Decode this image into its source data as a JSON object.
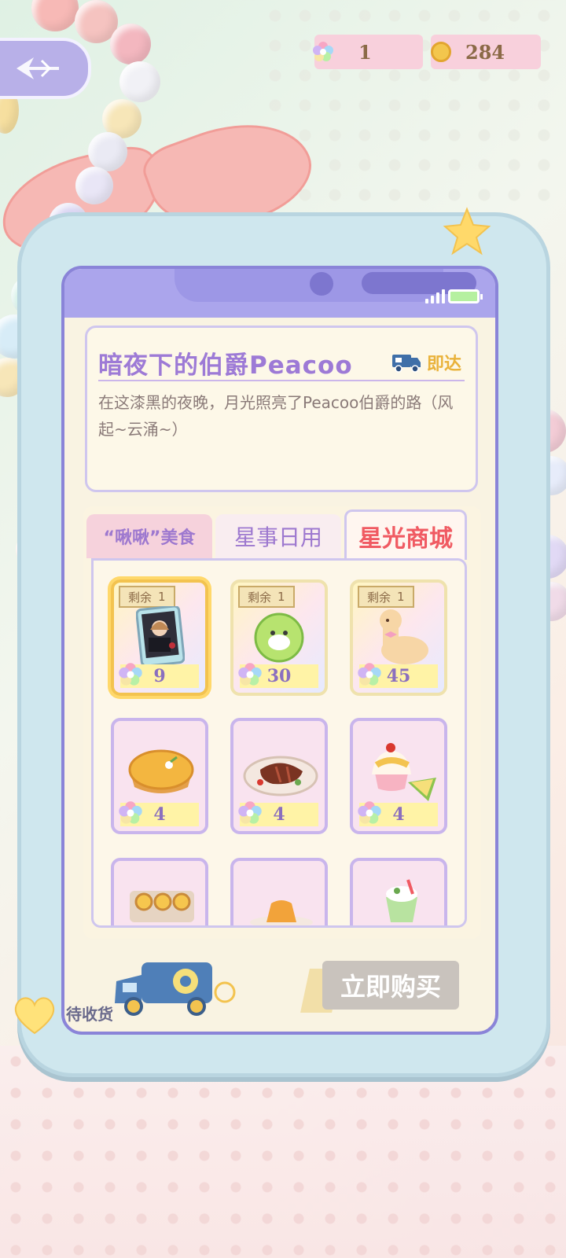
{
  "currency": {
    "stars": "1",
    "coins": "284",
    "star_icon": "rainbow-star-icon",
    "coin_icon": "gold-coin-icon"
  },
  "header": {
    "back_icon": "back-arrow-icon"
  },
  "product": {
    "title": "暗夜下的伯爵Peacoo",
    "express_label": "即达",
    "description": "在这漆黑的夜晚，月光照亮了Peacoo伯爵的路（风起~云涌~）"
  },
  "tabs": [
    {
      "label": "“啾啾”美食",
      "active": false
    },
    {
      "label": "星事日用",
      "active": false
    },
    {
      "label": "星光商城",
      "active": true
    }
  ],
  "items": [
    {
      "remain_label": "剩余",
      "remain": "1",
      "price": "9",
      "icon": "photo-card-icon"
    },
    {
      "remain_label": "剩余",
      "remain": "1",
      "price": "30",
      "icon": "green-ball-icon"
    },
    {
      "remain_label": "剩余",
      "remain": "1",
      "price": "45",
      "icon": "alpaca-plush-icon"
    },
    {
      "price": "4",
      "icon": "pumpkin-pie-icon"
    },
    {
      "price": "4",
      "icon": "steak-plate-icon"
    },
    {
      "price": "4",
      "icon": "durian-shaved-ice-icon"
    },
    {
      "icon": "egg-tarts-icon"
    },
    {
      "icon": "pudding-icon"
    },
    {
      "icon": "matcha-drink-icon"
    }
  ],
  "bottom": {
    "pending_label": "待收货",
    "buy_label": "立即购买"
  },
  "colors": {
    "accent_purple": "#9d7ad6",
    "active_tab": "#f05a62",
    "price_text": "#8a6fbf"
  }
}
